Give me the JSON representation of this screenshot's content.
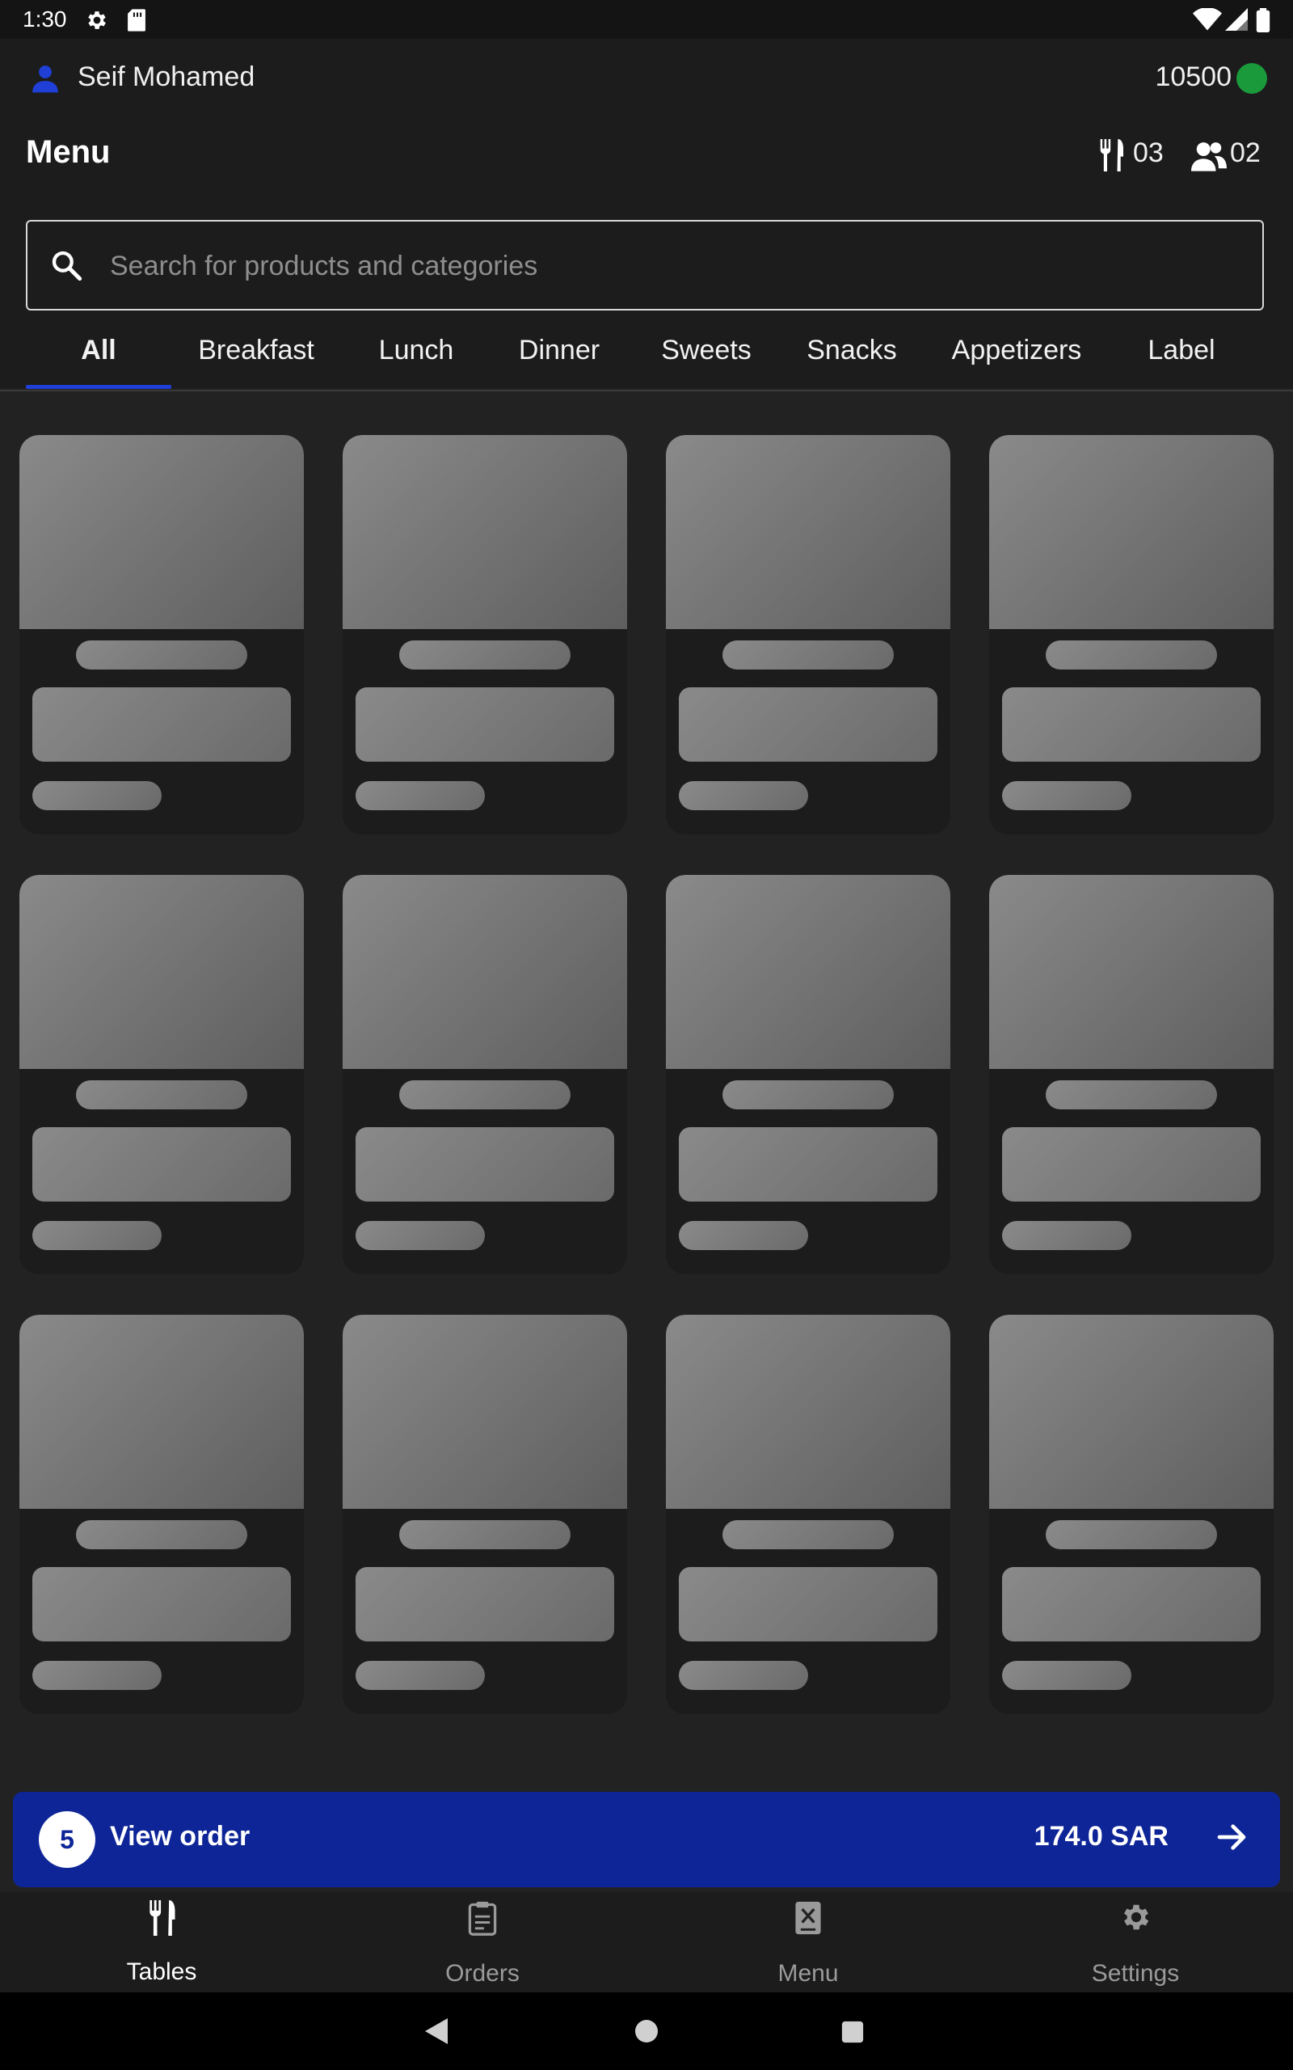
{
  "status_bar": {
    "time": "1:30",
    "icons": [
      "gear-icon",
      "sd-card-icon",
      "wifi-icon",
      "signal-icon",
      "battery-icon"
    ]
  },
  "header": {
    "user_name": "Seif Mohamed",
    "balance": "10500",
    "status_color": "#1a9a3a",
    "title": "Menu",
    "tables_count": "03",
    "guests_count": "02"
  },
  "search": {
    "placeholder": "Search for products and categories"
  },
  "tabs": [
    {
      "label": "All",
      "active": true
    },
    {
      "label": "Breakfast"
    },
    {
      "label": "Lunch"
    },
    {
      "label": "Dinner"
    },
    {
      "label": "Sweets"
    },
    {
      "label": "Snacks"
    },
    {
      "label": "Appetizers"
    },
    {
      "label": "Label"
    }
  ],
  "order_bar": {
    "item_count": "5",
    "label": "View order",
    "total": "174.0 SAR",
    "color": "#0e2597"
  },
  "bottom_nav": [
    {
      "label": "Tables",
      "icon": "utensils-icon",
      "active": true
    },
    {
      "label": "Orders",
      "icon": "clipboard-icon"
    },
    {
      "label": "Menu",
      "icon": "menu-book-icon"
    },
    {
      "label": "Settings",
      "icon": "gear-icon"
    }
  ],
  "colors": {
    "accent": "#1f3fd6",
    "background": "#222222",
    "surface": "#1c1c1c"
  }
}
